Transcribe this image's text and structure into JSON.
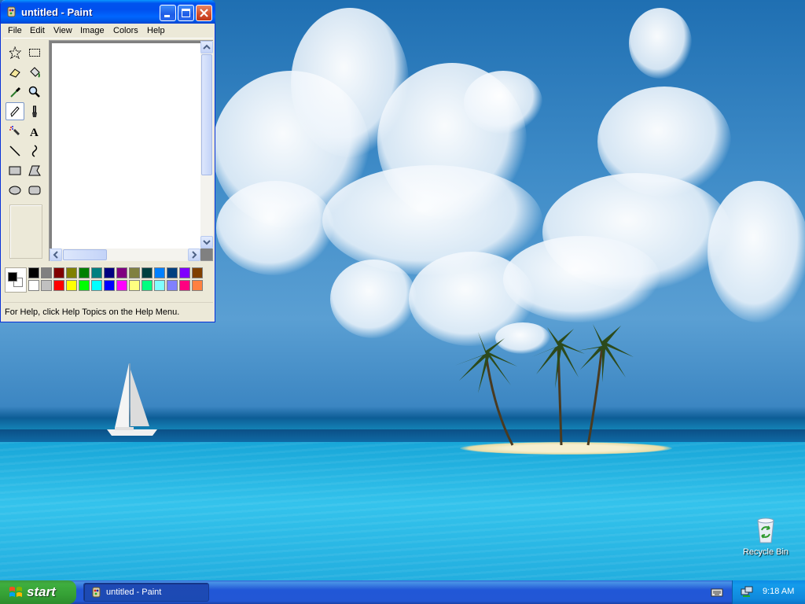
{
  "window": {
    "title": "untitled - Paint",
    "menus": [
      "File",
      "Edit",
      "View",
      "Image",
      "Colors",
      "Help"
    ],
    "status_text": "For Help, click Help Topics on the Help Menu."
  },
  "tools": [
    {
      "icon": "free-form-select-icon"
    },
    {
      "icon": "select-icon"
    },
    {
      "icon": "eraser-icon"
    },
    {
      "icon": "fill-icon"
    },
    {
      "icon": "pick-color-icon"
    },
    {
      "icon": "magnifier-icon"
    },
    {
      "icon": "pencil-icon",
      "selected": true
    },
    {
      "icon": "brush-icon"
    },
    {
      "icon": "airbrush-icon"
    },
    {
      "icon": "text-icon",
      "glyph": "A"
    },
    {
      "icon": "line-icon"
    },
    {
      "icon": "curve-icon"
    },
    {
      "icon": "rectangle-icon"
    },
    {
      "icon": "polygon-icon"
    },
    {
      "icon": "ellipse-icon"
    },
    {
      "icon": "rounded-rectangle-icon"
    }
  ],
  "palette": {
    "foreground": "#000000",
    "background": "#ffffff",
    "top_row": [
      "#000000",
      "#808080",
      "#800000",
      "#808000",
      "#008000",
      "#008080",
      "#000080",
      "#800080",
      "#808040",
      "#004040",
      "#0080ff",
      "#004080",
      "#8000ff",
      "#804000"
    ],
    "bottom_row": [
      "#ffffff",
      "#c0c0c0",
      "#ff0000",
      "#ffff00",
      "#00ff00",
      "#00ffff",
      "#0000ff",
      "#ff00ff",
      "#ffff80",
      "#00ff80",
      "#80ffff",
      "#8080ff",
      "#ff0080",
      "#ff8040"
    ]
  },
  "desktop": {
    "icons": [
      {
        "label": "Recycle Bin",
        "icon": "recycle-bin-icon"
      }
    ]
  },
  "taskbar": {
    "start_label": "start",
    "tasks": [
      {
        "label": "untitled - Paint",
        "icon": "paint-icon"
      }
    ],
    "clock": "9:18 AM"
  }
}
